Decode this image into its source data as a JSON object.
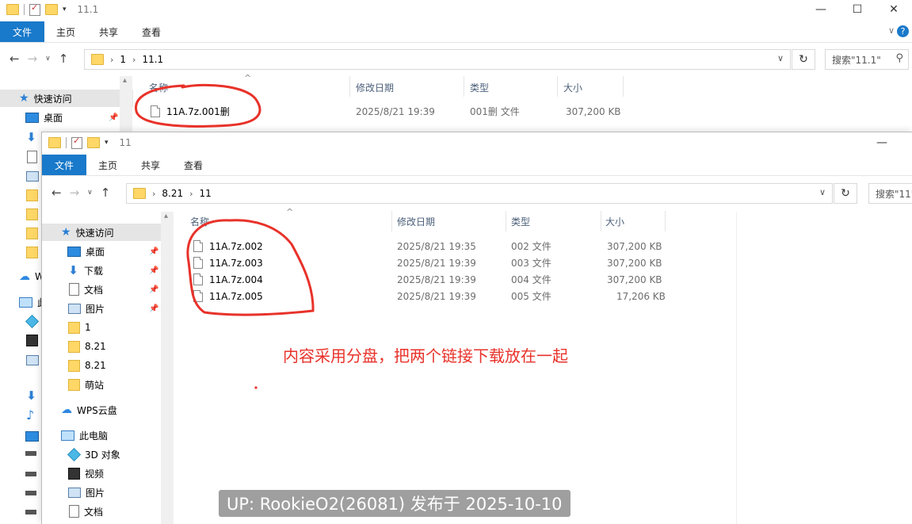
{
  "back_window": {
    "title": "11.1",
    "ribbon_tabs": [
      "文件",
      "主页",
      "共享",
      "查看"
    ],
    "breadcrumb": [
      "1",
      "11.1"
    ],
    "search_placeholder": "搜索\"11.1\"",
    "columns": [
      "名称",
      "修改日期",
      "类型",
      "大小"
    ],
    "files": [
      {
        "name": "11A.7z.001删",
        "modified": "2025/8/21 19:39",
        "type": "001删 文件",
        "size": "307,200 KB"
      }
    ],
    "nav": {
      "quick_access": "快速访问",
      "desktop": "桌面",
      "wps_prefix": "W",
      "pc_prefix": "此"
    }
  },
  "front_window": {
    "title": "11",
    "ribbon_tabs": [
      "文件",
      "主页",
      "共享",
      "查看"
    ],
    "breadcrumb": [
      "8.21",
      "11"
    ],
    "search_placeholder": "搜索\"11\"",
    "columns": [
      "名称",
      "修改日期",
      "类型",
      "大小"
    ],
    "files": [
      {
        "name": "11A.7z.002",
        "modified": "2025/8/21 19:35",
        "type": "002 文件",
        "size": "307,200 KB"
      },
      {
        "name": "11A.7z.003",
        "modified": "2025/8/21 19:39",
        "type": "003 文件",
        "size": "307,200 KB"
      },
      {
        "name": "11A.7z.004",
        "modified": "2025/8/21 19:39",
        "type": "004 文件",
        "size": "307,200 KB"
      },
      {
        "name": "11A.7z.005",
        "modified": "2025/8/21 19:39",
        "type": "005 文件",
        "size": "17,206 KB"
      }
    ],
    "nav": {
      "quick_access": "快速访问",
      "quick_items": [
        {
          "label": "桌面",
          "icon": "desktop-icon"
        },
        {
          "label": "下载",
          "icon": "download-icon"
        },
        {
          "label": "文档",
          "icon": "document-icon"
        },
        {
          "label": "图片",
          "icon": "picture-icon"
        },
        {
          "label": "1",
          "icon": "folder-icon"
        },
        {
          "label": "8.21",
          "icon": "folder-icon"
        },
        {
          "label": "8.21",
          "icon": "folder-icon"
        },
        {
          "label": "萌站",
          "icon": "folder-icon"
        }
      ],
      "wps_cloud": "WPS云盘",
      "this_pc": "此电脑",
      "pc_items": [
        {
          "label": "3D 对象",
          "icon": "3d-objects-icon"
        },
        {
          "label": "视频",
          "icon": "video-icon"
        },
        {
          "label": "图片",
          "icon": "picture-icon"
        },
        {
          "label": "文档",
          "icon": "document-icon"
        }
      ]
    }
  },
  "annotation": {
    "text": "内容采用分盘，把两个链接下载放在一起",
    "color": "#e8322a"
  },
  "watermark": {
    "text": "UP: RookieO2(26081) 发布于 2025-10-10"
  },
  "colors": {
    "accent": "#1979ca"
  }
}
